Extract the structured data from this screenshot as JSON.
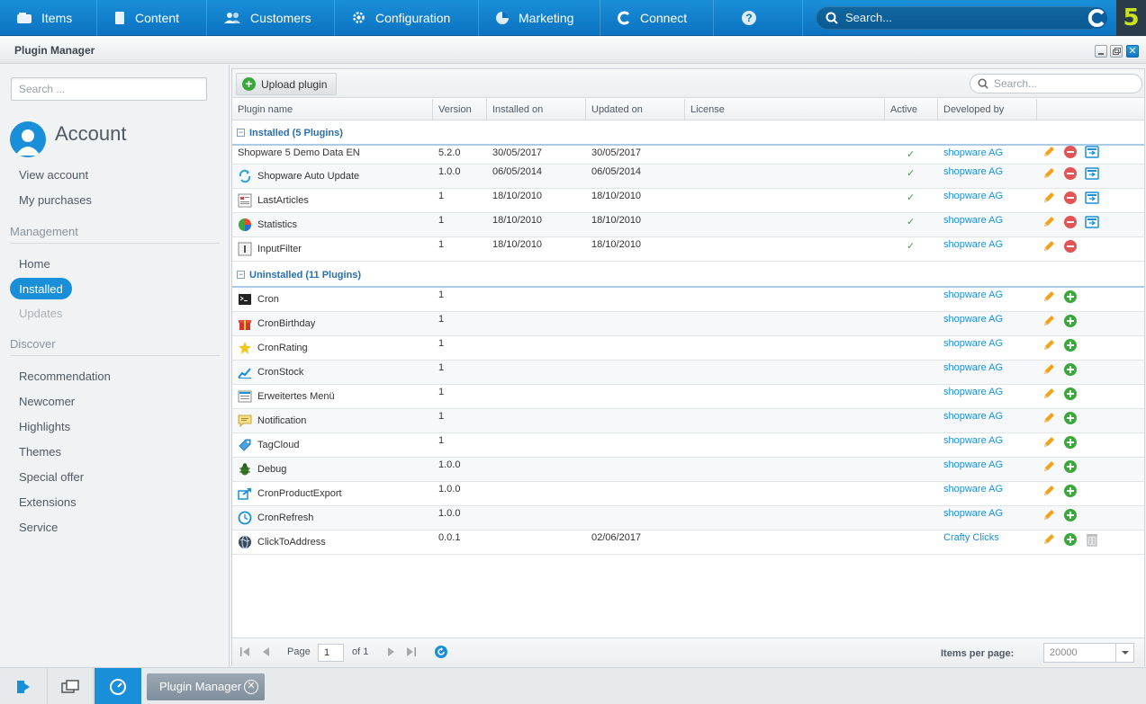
{
  "topnav": {
    "items": [
      {
        "label": "Items",
        "icon": "items-icon"
      },
      {
        "label": "Content",
        "icon": "content-icon"
      },
      {
        "label": "Customers",
        "icon": "customers-icon"
      },
      {
        "label": "Configuration",
        "icon": "gear-icon"
      },
      {
        "label": "Marketing",
        "icon": "pie-chart-icon"
      },
      {
        "label": "Connect",
        "icon": "connect-icon"
      }
    ],
    "search_placeholder": "Search..."
  },
  "window": {
    "title": "Plugin Manager"
  },
  "sidebar": {
    "search_placeholder": "Search ...",
    "account_title": "Account",
    "account_links": [
      "View account",
      "My purchases"
    ],
    "management_heading": "Management",
    "management_links": [
      "Home",
      "Installed",
      "Updates"
    ],
    "discover_heading": "Discover",
    "discover_links": [
      "Recommendation",
      "Newcomer",
      "Highlights",
      "Themes",
      "Special offer",
      "Extensions",
      "Service"
    ]
  },
  "toolbar": {
    "upload_label": "Upload plugin",
    "search_placeholder": "Search..."
  },
  "columns": [
    "Plugin name",
    "Version",
    "Installed on",
    "Updated on",
    "License",
    "Active",
    "Developed by"
  ],
  "groups": {
    "installed": {
      "label": "Installed (5 Plugins)",
      "rows": [
        {
          "name": "Shopware 5 Demo Data EN",
          "icon": "none",
          "version": "5.2.0",
          "installed": "30/05/2017",
          "updated": "30/05/2017",
          "active": true,
          "dev": "shopware AG",
          "update": true
        },
        {
          "name": "Shopware Auto Update",
          "icon": "refresh",
          "version": "1.0.0",
          "installed": "06/05/2014",
          "updated": "06/05/2014",
          "active": true,
          "dev": "shopware AG",
          "update": true
        },
        {
          "name": "LastArticles",
          "icon": "list",
          "version": "1",
          "installed": "18/10/2010",
          "updated": "18/10/2010",
          "active": true,
          "dev": "shopware AG",
          "update": true
        },
        {
          "name": "Statistics",
          "icon": "pie",
          "version": "1",
          "installed": "18/10/2010",
          "updated": "18/10/2010",
          "active": true,
          "dev": "shopware AG",
          "update": true
        },
        {
          "name": "InputFilter",
          "icon": "cursor",
          "version": "1",
          "installed": "18/10/2010",
          "updated": "18/10/2010",
          "active": true,
          "dev": "shopware AG",
          "update": false
        }
      ]
    },
    "uninstalled": {
      "label": "Uninstalled (11 Plugins)",
      "rows": [
        {
          "name": "Cron",
          "icon": "terminal",
          "version": "1",
          "updated": "",
          "dev": "shopware AG",
          "trash": false
        },
        {
          "name": "CronBirthday",
          "icon": "gift",
          "version": "1",
          "updated": "",
          "dev": "shopware AG",
          "trash": false
        },
        {
          "name": "CronRating",
          "icon": "star",
          "version": "1",
          "updated": "",
          "dev": "shopware AG",
          "trash": false
        },
        {
          "name": "CronStock",
          "icon": "trend",
          "version": "1",
          "updated": "",
          "dev": "shopware AG",
          "trash": false
        },
        {
          "name": "Erweitertes Menü",
          "icon": "menu",
          "version": "1",
          "updated": "",
          "dev": "shopware AG",
          "trash": false
        },
        {
          "name": "Notification",
          "icon": "note",
          "version": "1",
          "updated": "",
          "dev": "shopware AG",
          "trash": false
        },
        {
          "name": "TagCloud",
          "icon": "tag",
          "version": "1",
          "updated": "",
          "dev": "shopware AG",
          "trash": false
        },
        {
          "name": "Debug",
          "icon": "bug",
          "version": "1.0.0",
          "updated": "",
          "dev": "shopware AG",
          "trash": false
        },
        {
          "name": "CronProductExport",
          "icon": "export",
          "version": "1.0.0",
          "updated": "",
          "dev": "shopware AG",
          "trash": false
        },
        {
          "name": "CronRefresh",
          "icon": "clock",
          "version": "1.0.0",
          "updated": "",
          "dev": "shopware AG",
          "trash": false
        },
        {
          "name": "ClickToAddress",
          "icon": "globe",
          "version": "0.0.1",
          "updated": "02/06/2017",
          "dev": "Crafty Clicks",
          "trash": true
        }
      ]
    }
  },
  "pager": {
    "page_label": "Page",
    "page_value": "1",
    "of_label": "of 1",
    "items_per_page_label": "Items per page:",
    "items_per_page_value": "20000"
  },
  "taskbar": {
    "task_label": "Plugin Manager"
  },
  "colors": {
    "accent": "#1a8fd9",
    "nav_dark": "#0b72c0",
    "success": "#3aa83a",
    "danger": "#e05555",
    "link": "#1a8fd9"
  }
}
